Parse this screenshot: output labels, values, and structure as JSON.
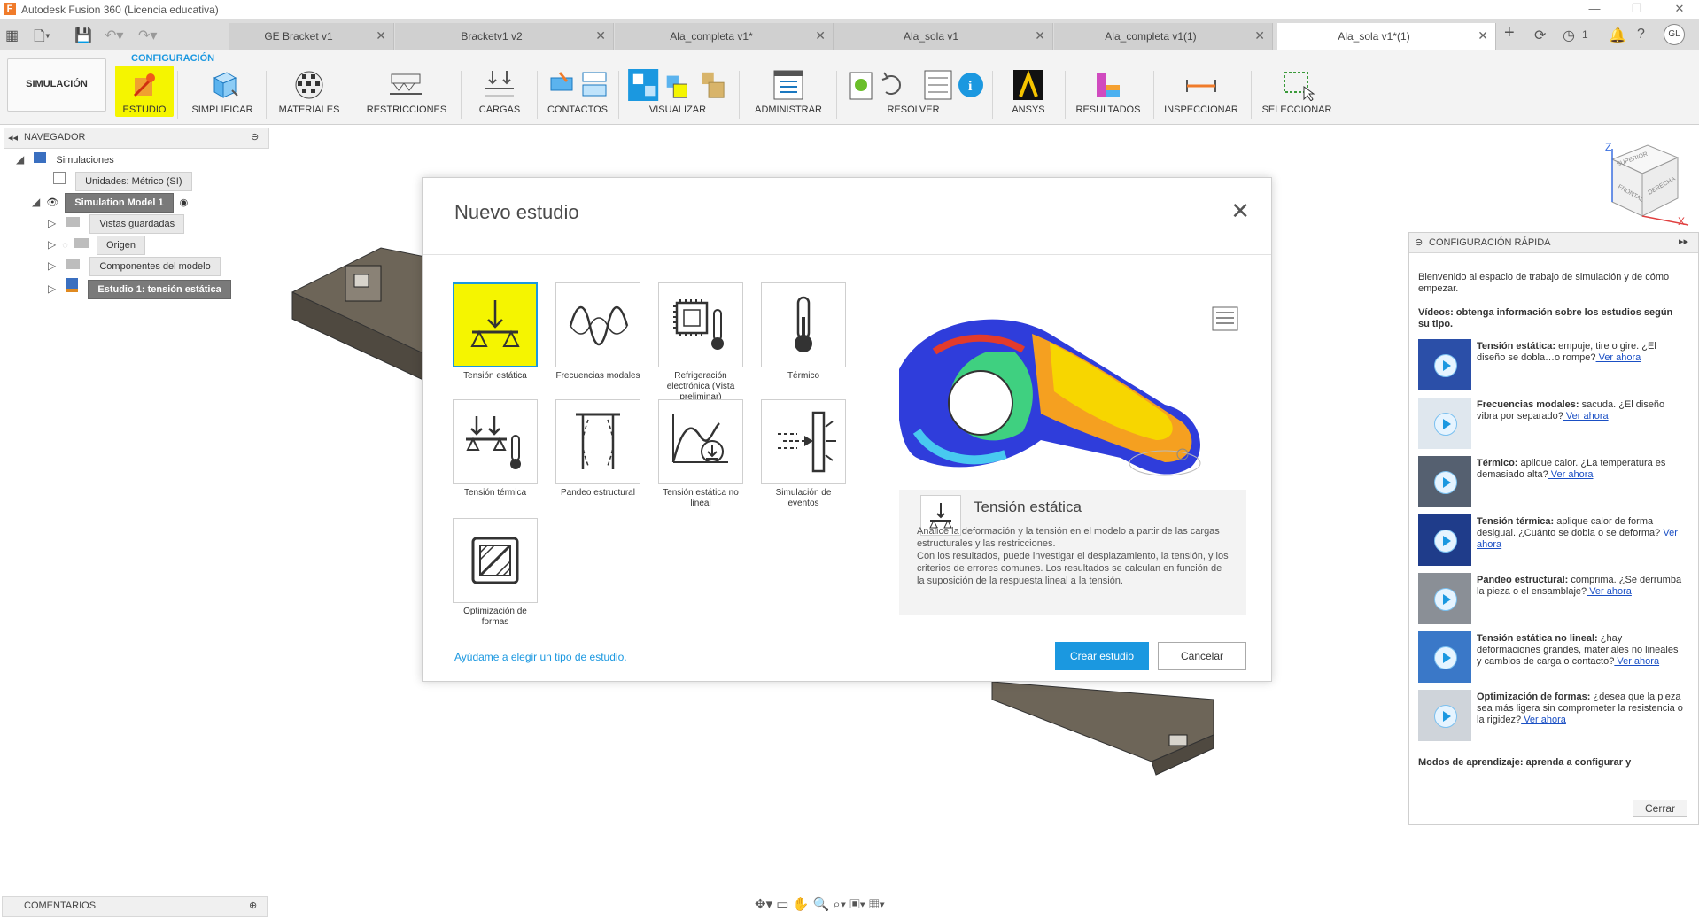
{
  "window": {
    "title": "Autodesk Fusion 360 (Licencia educativa)"
  },
  "tabs": [
    {
      "label": "GE Bracket v1",
      "active": false
    },
    {
      "label": "Bracketv1 v2",
      "active": false
    },
    {
      "label": "Ala_completa v1*",
      "active": false
    },
    {
      "label": "Ala_sola v1",
      "active": false
    },
    {
      "label": "Ala_completa v1(1)",
      "active": false
    },
    {
      "label": "Ala_sola v1*(1)",
      "active": true
    }
  ],
  "toolbar_right": {
    "jobs_count": "1",
    "user_initials": "GL"
  },
  "ribbon": {
    "workspace": "SIMULACIÓN",
    "section": "CONFIGURACIÓN",
    "groups": [
      {
        "label": "ESTUDIO"
      },
      {
        "label": "SIMPLIFICAR"
      },
      {
        "label": "MATERIALES"
      },
      {
        "label": "RESTRICCIONES"
      },
      {
        "label": "CARGAS"
      },
      {
        "label": "CONTACTOS"
      },
      {
        "label": "VISUALIZAR"
      },
      {
        "label": "ADMINISTRAR"
      },
      {
        "label": "RESOLVER"
      },
      {
        "label": "ANSYS"
      },
      {
        "label": "RESULTADOS"
      },
      {
        "label": "INSPECCIONAR"
      },
      {
        "label": "SELECCIONAR"
      }
    ]
  },
  "navigator": {
    "title": "NAVEGADOR",
    "items": [
      {
        "label": "Simulaciones"
      },
      {
        "label": "Unidades: Métrico (SI)"
      },
      {
        "label": "Simulation Model 1"
      },
      {
        "label": "Vistas guardadas"
      },
      {
        "label": "Origen"
      },
      {
        "label": "Componentes del modelo"
      },
      {
        "label": "Estudio 1: tensión estática"
      }
    ]
  },
  "comments": {
    "label": "COMENTARIOS"
  },
  "viewcube": {
    "top": "SUPERIOR",
    "front": "FRONTAL",
    "right": "DERECHA",
    "z": "Z",
    "x": "X"
  },
  "dialog": {
    "title": "Nuevo estudio",
    "study_types": [
      {
        "label": "Tensión estática",
        "icon": "static-stress-icon",
        "selected": true
      },
      {
        "label": "Frecuencias modales",
        "icon": "modal-frequencies-icon",
        "selected": false
      },
      {
        "label": "Refrigeración electrónica (Vista preliminar)",
        "icon": "electronics-cooling-icon",
        "selected": false
      },
      {
        "label": "Térmico",
        "icon": "thermometer-icon",
        "selected": false
      },
      {
        "label": "Tensión térmica",
        "icon": "thermal-stress-icon",
        "selected": false
      },
      {
        "label": "Pandeo estructural",
        "icon": "structural-buckling-icon",
        "selected": false
      },
      {
        "label": "Tensión estática no lineal",
        "icon": "nonlinear-static-icon",
        "selected": false
      },
      {
        "label": "Simulación de eventos",
        "icon": "event-simulation-icon",
        "selected": false
      },
      {
        "label": "Optimización de formas",
        "icon": "shape-optimization-icon",
        "selected": false
      }
    ],
    "preview": {
      "title": "Tensión estática",
      "description": "Analice la deformación y la tensión en el modelo a partir de las cargas estructurales y las restricciones.\nCon los resultados, puede investigar el desplazamiento, la tensión, y los criterios de errores comunes. Los resultados se calculan en función de la suposición de la respuesta lineal a la tensión."
    },
    "help_link": "Ayúdame a elegir un tipo de estudio.",
    "create_label": "Crear estudio",
    "cancel_label": "Cancelar"
  },
  "quick_setup": {
    "title": "CONFIGURACIÓN RÁPIDA",
    "intro": "Bienvenido al espacio de trabajo de simulación y de cómo empezar.",
    "videos_heading": "Vídeos: obtenga información sobre los estudios según su tipo.",
    "items": [
      {
        "title": "Tensión estática:",
        "text": " empuje, tire o gire. ¿El diseño se dobla…o rompe?",
        "link": " Ver ahora"
      },
      {
        "title": "Frecuencias modales:",
        "text": " sacuda. ¿El diseño vibra por separado?",
        "link": " Ver ahora"
      },
      {
        "title": "Térmico:",
        "text": " aplique calor. ¿La temperatura es demasiado alta?",
        "link": " Ver ahora"
      },
      {
        "title": "Tensión térmica:",
        "text": " aplique calor de forma desigual. ¿Cuánto se dobla o se deforma?",
        "link": " Ver ahora"
      },
      {
        "title": "Pandeo estructural:",
        "text": " comprima. ¿Se derrumba la pieza o el ensamblaje?",
        "link": " Ver ahora"
      },
      {
        "title": "Tensión estática no lineal:",
        "text": " ¿hay deformaciones grandes, materiales no lineales y cambios de carga o contacto?",
        "link": " Ver ahora"
      },
      {
        "title": "Optimización de formas:",
        "text": " ¿desea que la pieza sea más ligera sin comprometer la resistencia o la rigidez?",
        "link": " Ver ahora"
      }
    ],
    "learning_heading": "Modos de aprendizaje: aprenda a configurar y",
    "close_label": "Cerrar"
  }
}
